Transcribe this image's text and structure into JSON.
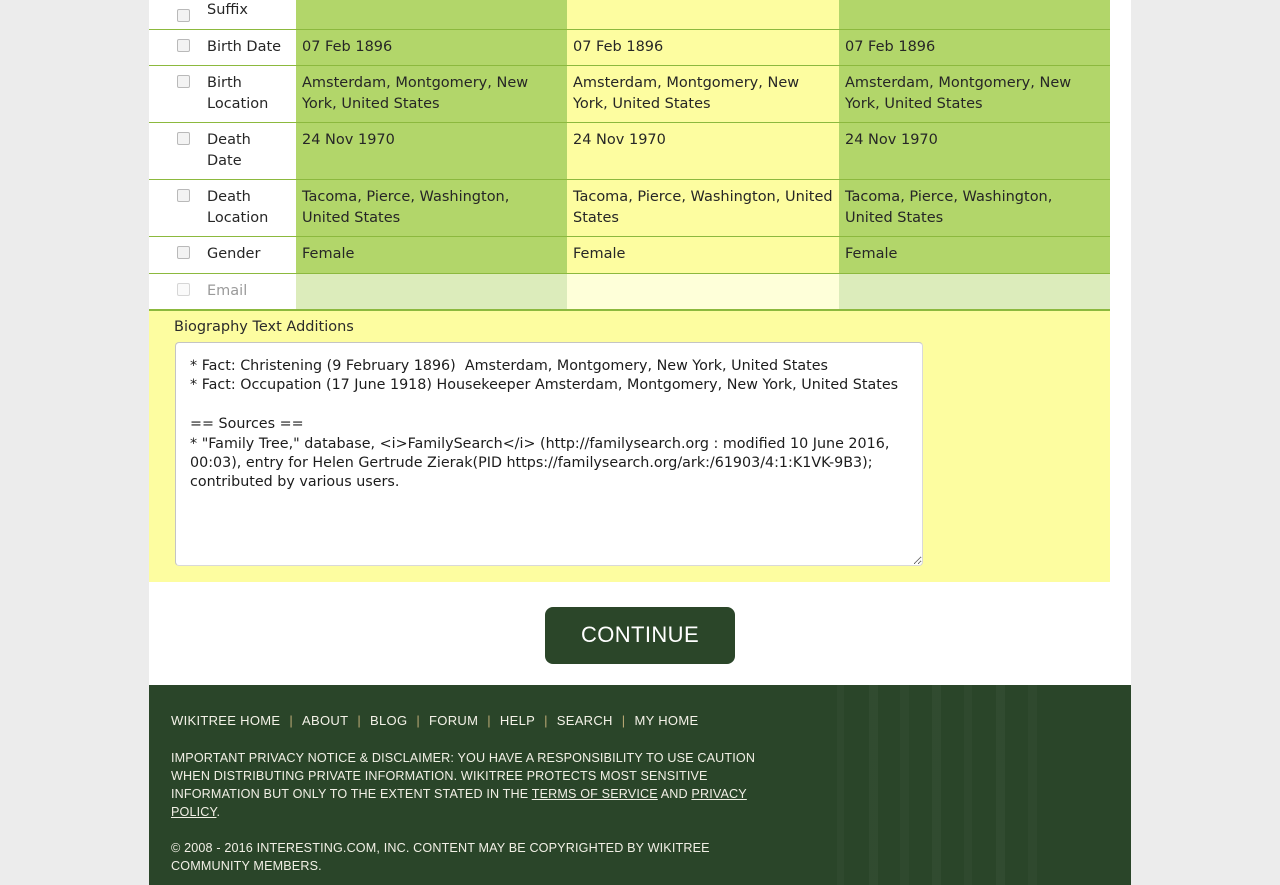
{
  "table": {
    "rows": [
      {
        "label": "Suffix",
        "a": "",
        "b": "",
        "c": "",
        "disabled": false,
        "cut": true
      },
      {
        "label": "Birth Date",
        "a": "07 Feb 1896",
        "b": "07 Feb 1896",
        "c": "07 Feb 1896",
        "disabled": false,
        "cut": false
      },
      {
        "label": "Birth Location",
        "a": "Amsterdam, Montgomery, New York, United States",
        "b": "Amsterdam, Montgomery, New York, United States",
        "c": "Amsterdam, Montgomery, New York, United States",
        "disabled": false,
        "cut": false
      },
      {
        "label": "Death Date",
        "a": "24 Nov 1970",
        "b": "24 Nov 1970",
        "c": "24 Nov 1970",
        "disabled": false,
        "cut": false
      },
      {
        "label": "Death Location",
        "a": "Tacoma, Pierce, Washington, United States",
        "b": "Tacoma, Pierce, Washington, United States",
        "c": "Tacoma, Pierce, Washington, United States",
        "disabled": false,
        "cut": false
      },
      {
        "label": "Gender",
        "a": "Female",
        "b": "Female",
        "c": "Female",
        "disabled": false,
        "cut": false
      },
      {
        "label": "Email",
        "a": "",
        "b": "",
        "c": "",
        "disabled": true,
        "cut": false
      }
    ]
  },
  "biography": {
    "label": "Biography Text Additions",
    "text": "* Fact: Christening (9 February 1896)  Amsterdam, Montgomery, New York, United States\n* Fact: Occupation (17 June 1918) Housekeeper Amsterdam, Montgomery, New York, United States\n\n== Sources ==\n* \"Family Tree,\" database, <i>FamilySearch</i> (http://familysearch.org : modified 10 June 2016, 00:03), entry for Helen Gertrude Zierak(PID https://familysearch.org/ark:/61903/4:1:K1VK-9B3); contributed by various users."
  },
  "actions": {
    "continue_label": "CONTINUE"
  },
  "footer": {
    "nav": [
      "WIKITREE HOME",
      "ABOUT",
      "BLOG",
      "FORUM",
      "HELP",
      "SEARCH",
      "MY HOME"
    ],
    "separator": "|",
    "disclaimer_prefix": "IMPORTANT PRIVACY NOTICE & DISCLAIMER: YOU HAVE A RESPONSIBILITY TO USE CAUTION WHEN DISTRIBUTING PRIVATE INFORMATION. WIKITREE PROTECTS MOST SENSITIVE INFORMATION BUT ONLY TO THE EXTENT STATED IN THE ",
    "terms_link": "TERMS OF SERVICE",
    "disclaimer_mid": " AND ",
    "privacy_link": "PRIVACY POLICY",
    "disclaimer_suffix": ".",
    "copyright": "© 2008 - 2016 INTERESTING.COM, INC. CONTENT MAY BE COPYRIGHTED BY WIKITREE COMMUNITY MEMBERS."
  },
  "colors": {
    "column_match": "#b2d66a",
    "column_alt": "#fdfda0",
    "footer_bg": "#2a4529",
    "button_bg": "#2b4629"
  }
}
